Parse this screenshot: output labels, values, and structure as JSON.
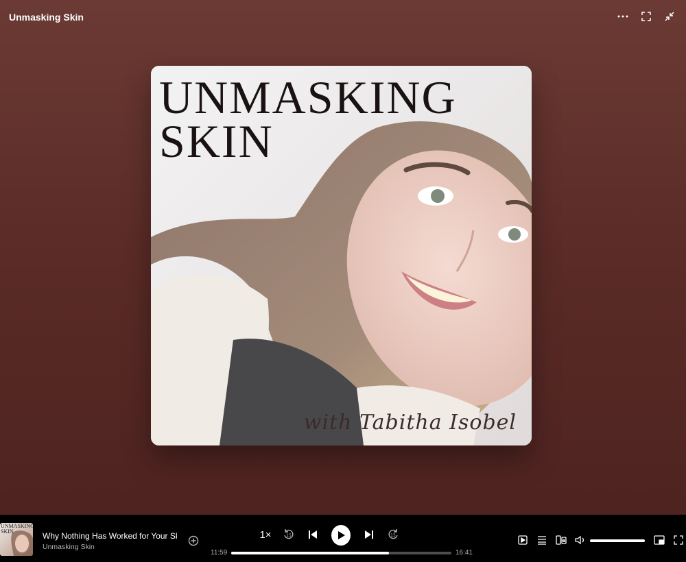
{
  "window": {
    "title": "Unmasking Skin"
  },
  "top_actions": [
    {
      "name": "more-options-icon"
    },
    {
      "name": "fullscreen-icon"
    },
    {
      "name": "minimize-icon"
    }
  ],
  "artwork": {
    "title_line1": "UNMASKING",
    "title_line2": "SKIN",
    "subtitle": "with Tabitha Isobel"
  },
  "player": {
    "thumb_text": "UNMASKING SKIN",
    "track_title": "Why Nothing Has Worked for Your Skin",
    "artist": "Unmasking Skin",
    "speed_label": "1×",
    "skip_back_label": "15",
    "skip_forward_label": "15",
    "elapsed": "11:59",
    "duration": "16:41",
    "progress": 0.718,
    "volume": 1.0
  },
  "colors": {
    "background_top": "#6b3a34",
    "background_bottom": "#4e2320",
    "player_bg": "#000000"
  }
}
